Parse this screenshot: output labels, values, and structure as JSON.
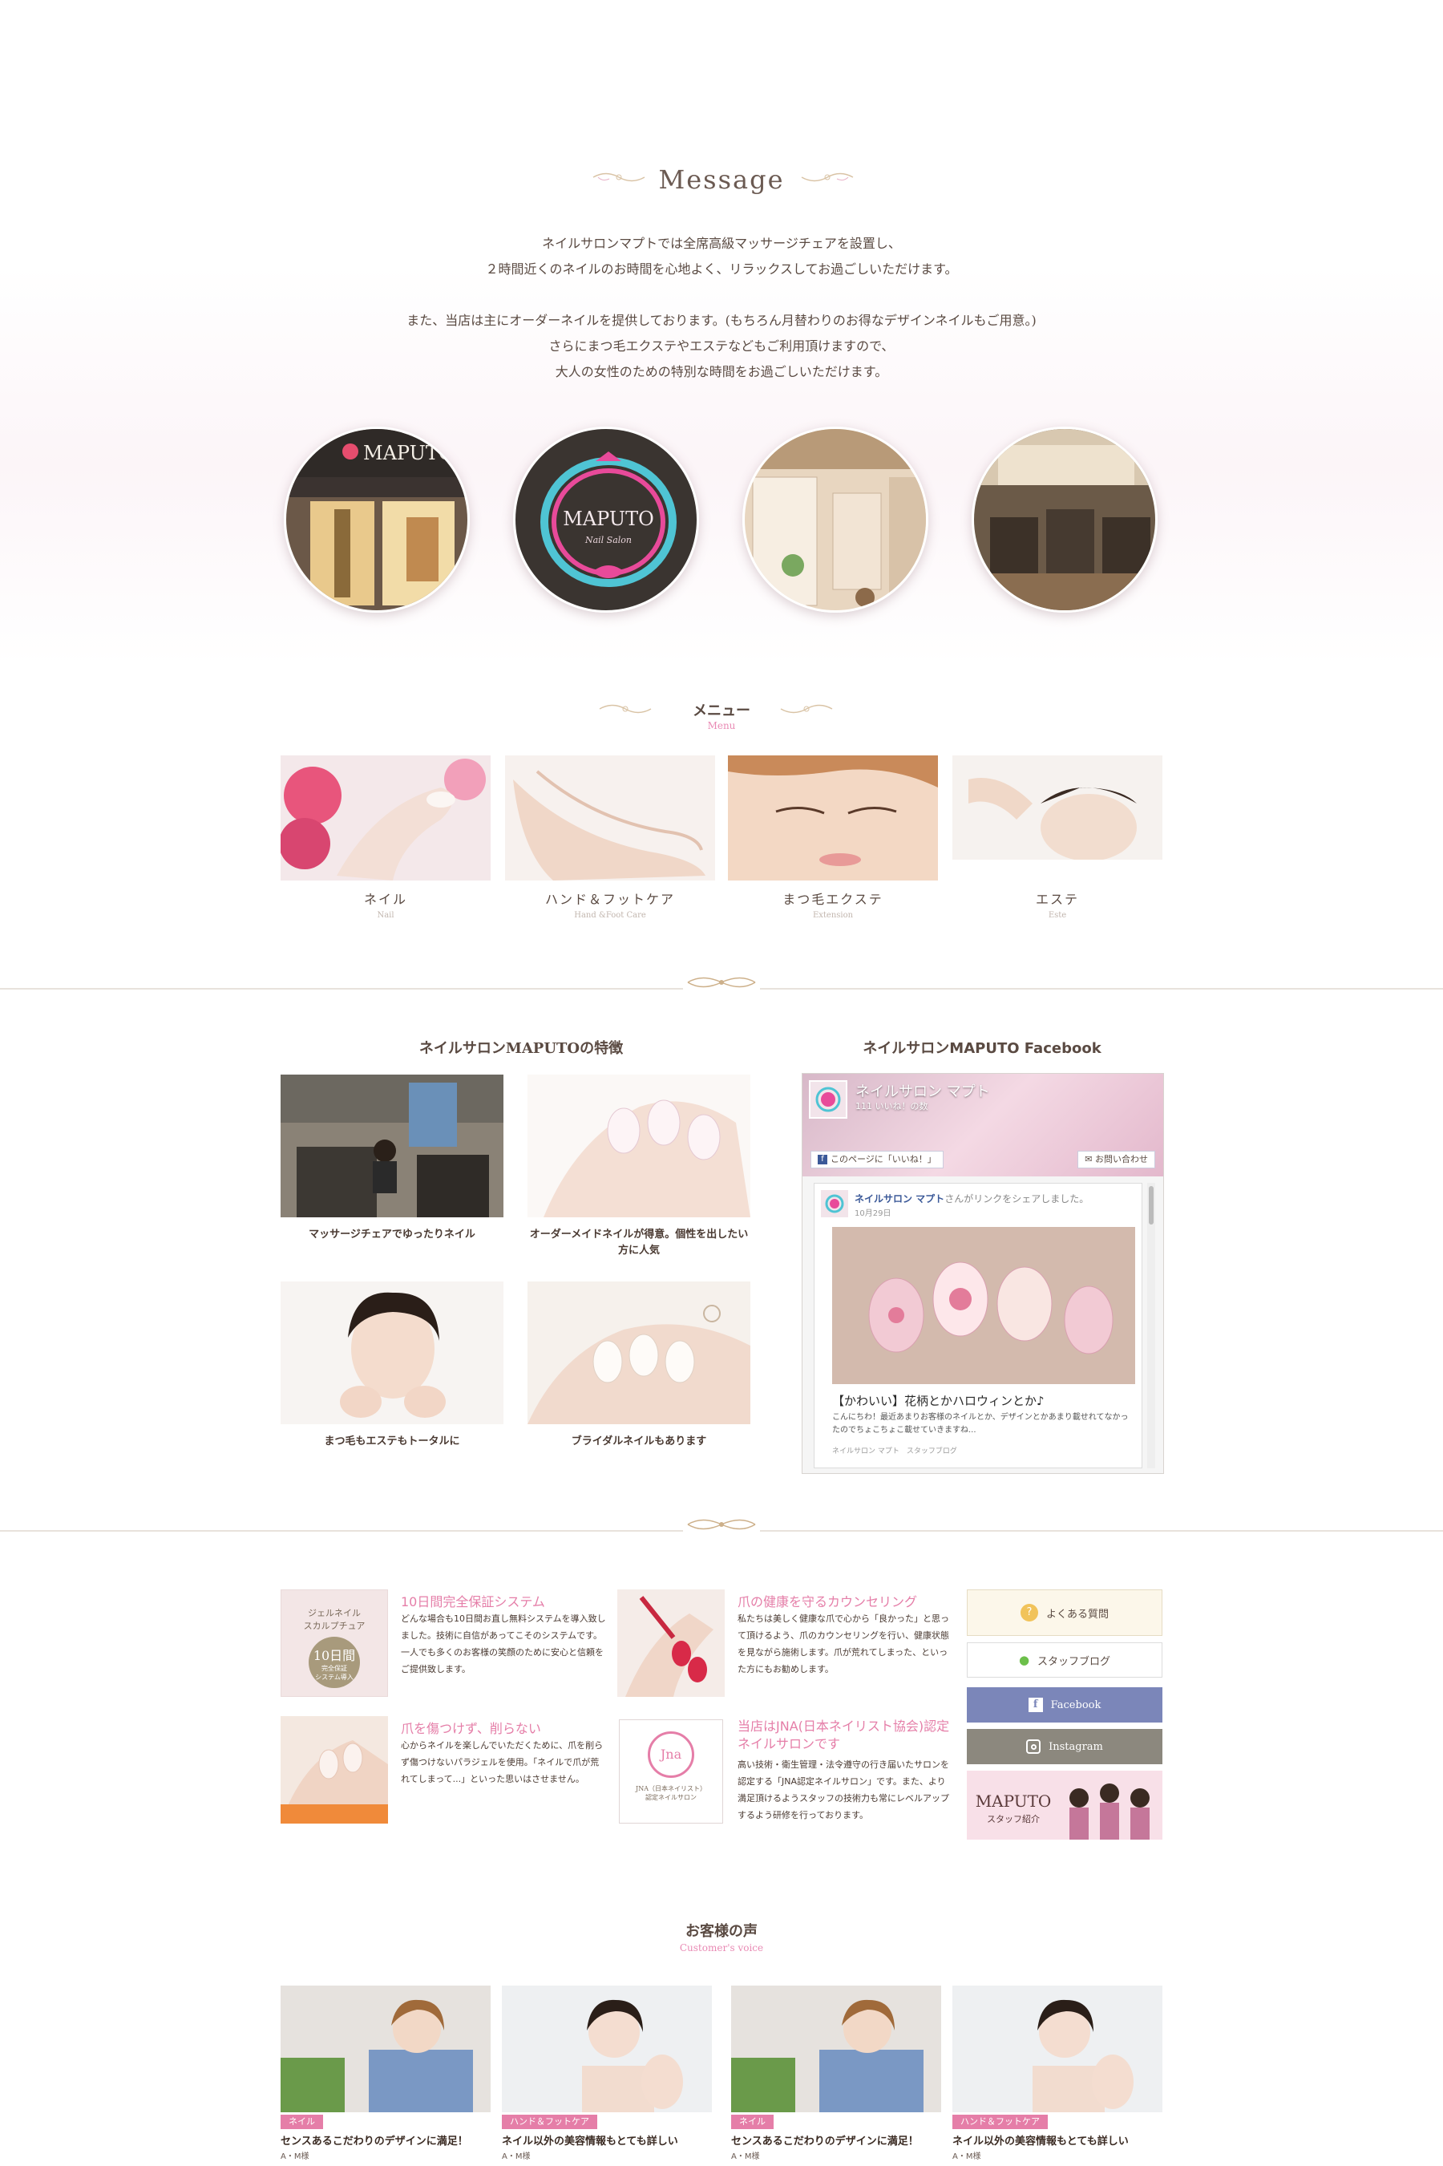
{
  "message": {
    "title": "Message",
    "lines": [
      "ネイルサロンマプトでは全席高級マッサージチェアを設置し、",
      "２時間近くのネイルのお時間を心地よく、リラックスしてお過ごしいただけます。",
      "また、当店は主にオーダーネイルを提供しております。(もちろん月替わりのお得なデザインネイルもご用意。)",
      "さらにまつ毛エクステやエステなどもご利用頂けますので、",
      "大人の女性のための特別な時間をお過ごしいただけます。"
    ],
    "photos": [
      {
        "name": "storefront-photo",
        "sign": "MAPUTO"
      },
      {
        "name": "logo-photo",
        "sign": "MAPUTO",
        "sub": "Nail Salon"
      },
      {
        "name": "salon-interior-photo"
      },
      {
        "name": "chair-interior-photo"
      }
    ]
  },
  "menu": {
    "title": "メニュー",
    "subtitle": "Menu",
    "items": [
      {
        "jp": "ネイル",
        "en": "Nail"
      },
      {
        "jp": "ハンド＆フットケア",
        "en": "Hand &Foot Care"
      },
      {
        "jp": "まつ毛エクステ",
        "en": "Extension"
      },
      {
        "jp": "エステ",
        "en": "Este"
      }
    ]
  },
  "features": {
    "title": "ネイルサロンMAPUTOの特徴",
    "items": [
      {
        "caption": "マッサージチェアでゆったりネイル"
      },
      {
        "caption": "オーダーメイドネイルが得意。個性を出したい方に人気"
      },
      {
        "caption": "まつ毛もエステもトータルに"
      },
      {
        "caption": "ブライダルネイルもあります"
      }
    ]
  },
  "facebook": {
    "title": "ネイルサロンMAPUTO Facebook",
    "page_name": "ネイルサロン マプト",
    "likes": "111 いいね！の数",
    "like_btn": "このページに「いいね！」",
    "contact_btn": "お問い合わせ",
    "post_author": "ネイルサロン マプト",
    "post_action": "さんがリンクをシェアしました。",
    "post_date": "10月29日",
    "post_title": "【かわいい】花柄とかハロウィンとか♪",
    "post_text": "こんにちわ！最近あまりお客様のネイルとか、デザインとかあまり載せれてなかったのでちょこちょこ載せていきますね...",
    "post_source": "ネイルサロン マプト　スタッフブログ"
  },
  "blocks": [
    {
      "title": "10日間完全保証システム",
      "text": "どんな場合も10日間お直し無料システムを導入致しました。技術に自信があってこそのシステムです。一人でも多くのお客様の笑顔のために安心と信頼をご提供致します。",
      "thumb_lines": [
        "ジェルネイル",
        "スカルプチュア",
        "10日間",
        "完全保証",
        "システム導入"
      ]
    },
    {
      "title": "爪の健康を守るカウンセリング",
      "text": "私たちは美しく健康な爪で心から「良かった」と思って頂けるよう、爪のカウンセリングを行い、健康状態を見ながら施術します。爪が荒れてしまった、といった方にもお勧めします。"
    },
    {
      "title": "爪を傷つけず、削らない",
      "text": "心からネイルを楽しんでいただくために、爪を削らず傷つけないパラジェルを使用。「ネイルで爪が荒れてしまって...」といった思いはさせません。"
    },
    {
      "title": "当店はJNA(日本ネイリスト協会)認定ネイルサロンです",
      "text": "高い技術・衛生管理・法令遵守の行き届いたサロンを認定する「JNA認定ネイルサロン」です。また、より満足頂けるようスタッフの技術力も常にレベルアップするよう研修を行っております。",
      "thumb_lines": [
        "JNA（日本ネイリスト）",
        "認定ネイルサロン"
      ]
    }
  ],
  "side": {
    "faq": "よくある質問",
    "blog": "スタッフブログ",
    "facebook": "Facebook",
    "instagram": "Instagram",
    "staff_title": "MAPUTO",
    "staff_sub": "スタッフ紹介"
  },
  "voices": {
    "title": "お客様の声",
    "subtitle": "Customer's voice",
    "items": [
      {
        "badge": "ネイル",
        "text": "センスあるこだわりのデザインに満足！",
        "name": "A・M様"
      },
      {
        "badge": "ハンド＆フットケア",
        "text": "ネイル以外の美容情報もとても詳しい",
        "name": "A・M様"
      },
      {
        "badge": "ネイル",
        "text": "センスあるこだわりのデザインに満足！",
        "name": "A・M様"
      },
      {
        "badge": "ハンド＆フットケア",
        "text": "ネイル以外の美容情報もとても詳しい",
        "name": "A・M様"
      }
    ]
  },
  "colors": {
    "pink": "#e57ea8",
    "brown": "#5a4a42",
    "gold": "#c8b08a",
    "fb_blue": "#7b86b9",
    "insta_gray": "#8c887e"
  }
}
